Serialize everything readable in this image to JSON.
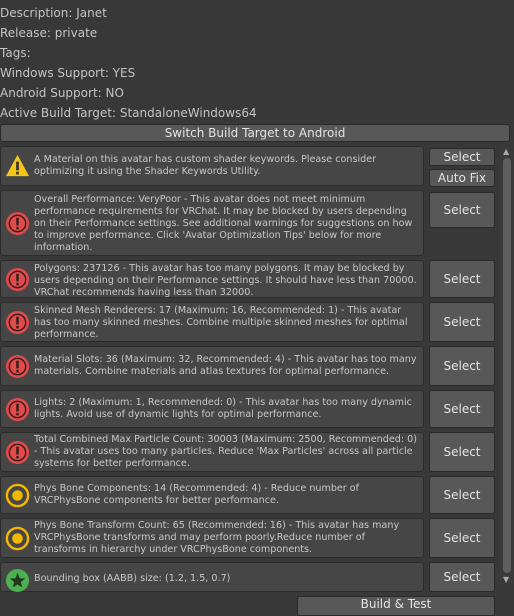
{
  "info": {
    "description": "Description: Janet",
    "release": "Release: private",
    "tags": "Tags:",
    "windows_support": "Windows Support: YES",
    "android_support": "Android Support: NO",
    "active_build_target": "Active Build Target: StandaloneWindows64"
  },
  "switch_button_label": "Switch Build Target to Android",
  "messages": [
    {
      "text": "A Material on this avatar has custom shader keywords. Please consider optimizing it using the Shader Keywords Utility.",
      "icon": "warning-icon",
      "button": "Select",
      "second_button": "Auto Fix"
    },
    {
      "text": "Overall Performance: VeryPoor - This avatar does not meet minimum performance requirements for VRChat. It may be blocked by users depending on their Performance settings. See additional warnings for suggestions on how to improve performance. Click 'Avatar Optimization Tips' below for more information.",
      "icon": "error-icon",
      "button": "Select"
    },
    {
      "text": "Polygons: 237126 - This avatar has too many polygons. It may be blocked by users depending on their Performance settings. It should have less than 70000. VRChat recommends having less than 32000.",
      "icon": "error-icon",
      "button": "Select"
    },
    {
      "text": "Skinned Mesh Renderers: 17 (Maximum: 16, Recommended: 1) - This avatar has too many skinned meshes. Combine multiple skinned meshes for optimal performance.",
      "icon": "error-icon",
      "button": "Select"
    },
    {
      "text": "Material Slots: 36 (Maximum: 32, Recommended: 4) - This avatar has too many materials. Combine materials and atlas textures for optimal performance.",
      "icon": "error-icon",
      "button": "Select"
    },
    {
      "text": "Lights: 2 (Maximum: 1, Recommended: 0) - This avatar has too many dynamic lights. Avoid use of dynamic lights for optimal performance.",
      "icon": "error-icon",
      "button": "Select"
    },
    {
      "text": "Total Combined Max Particle Count: 30003 (Maximum: 2500, Recommended: 0) - This avatar uses too many particles. Reduce 'Max Particles' across all particle systems for better performance.",
      "icon": "error-icon",
      "button": "Select"
    },
    {
      "text": "Phys Bone Components: 14 (Recommended: 4) - Reduce number of VRCPhysBone components for better performance.",
      "icon": "info-circle-icon",
      "button": "Select"
    },
    {
      "text": "Phys Bone Transform Count: 65 (Recommended: 16) - This avatar has many VRCPhysBone transforms and may perform poorly.Reduce number of transforms in hierarchy under VRCPhysBone components.",
      "icon": "info-circle-icon",
      "button": "Select"
    },
    {
      "text": "Bounding box (AABB) size: (1.2, 1.5, 0.7)",
      "icon": "star-icon",
      "button": "Select"
    }
  ],
  "build_button_label": "Build & Test",
  "colors": {
    "background": "#383838",
    "message_box": "#464646",
    "error_red": "#e04b4b",
    "warning_yellow": "#f5c518",
    "info_orange": "#f5b800",
    "success_green": "#4caf50"
  }
}
